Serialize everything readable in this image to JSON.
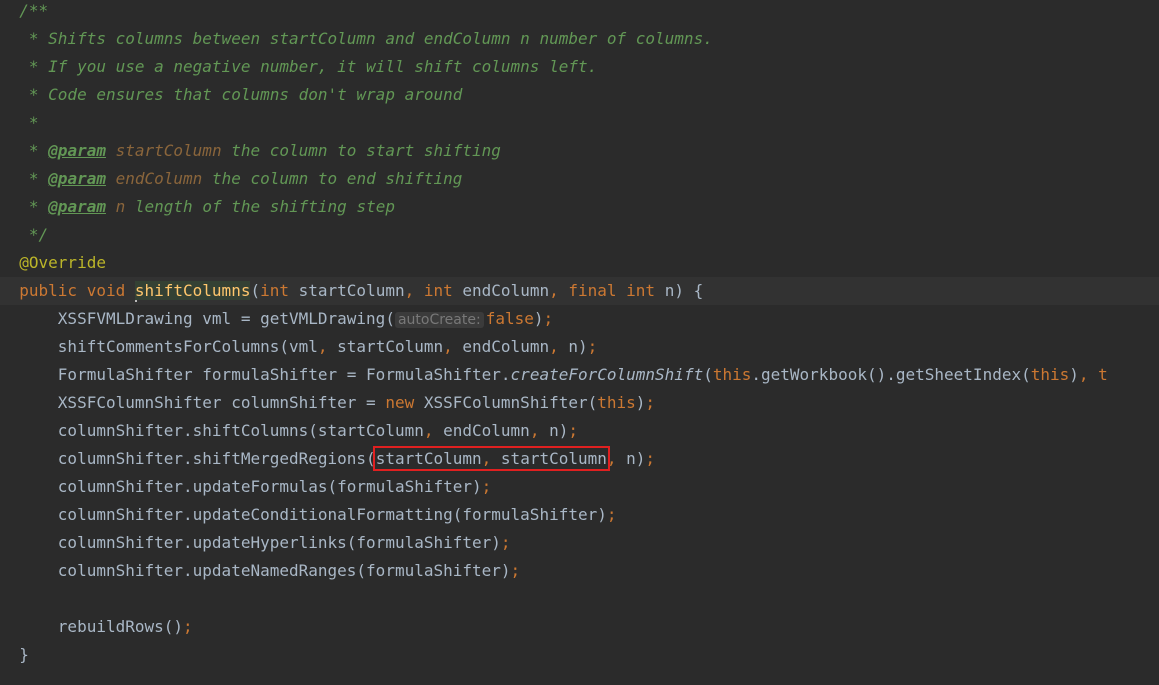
{
  "editor": {
    "theme_colors": {
      "background": "#2b2b2b",
      "text": "#a9b7c6",
      "doc_comment": "#629755",
      "keyword": "#cc7832",
      "annotation": "#bbb529",
      "method_declaration": "#ffc66d",
      "highlight_box": "#e02020"
    },
    "lines": {
      "l1": {
        "doc": "/**"
      },
      "l2": {
        "doc": " * Shifts columns between startColumn and endColumn n number of columns."
      },
      "l3": {
        "doc": " * If you use a negative number, it will shift columns left."
      },
      "l4": {
        "doc": " * Code ensures that columns don't wrap around"
      },
      "l5": {
        "doc": " *"
      },
      "l6": {
        "star": " * ",
        "tag": "@param",
        "name": "startColumn",
        "desc": " the column to start shifting"
      },
      "l7": {
        "star": " * ",
        "tag": "@param",
        "name": "endColumn",
        "desc": " the column to end shifting"
      },
      "l8": {
        "star": " * ",
        "tag": "@param",
        "name": "n",
        "desc": " length of the shifting step"
      },
      "l9": {
        "doc": " */"
      },
      "l10": {
        "annotation": "@Override"
      },
      "l11": {
        "kw1": "public void ",
        "method": "shiftColumns",
        "p1": "(",
        "kw2": "int",
        "p2": " startColumn",
        "c1": ", ",
        "kw3": "int",
        "p3": " endColumn",
        "c2": ", ",
        "kw4": "final int",
        "p4": " n) {"
      },
      "l12": {
        "a": "    XSSFVMLDrawing vml = getVMLDrawing(",
        "hint": "autoCreate:",
        "kw": "false",
        "b": ")",
        "semi": ";"
      },
      "l13": {
        "a": "    shiftCommentsForColumns(vml",
        "c1": ", ",
        "b": "startColumn",
        "c2": ", ",
        "c": "endColumn",
        "c3": ", ",
        "d": "n)",
        "semi": ";"
      },
      "l14": {
        "a": "    FormulaShifter formulaShifter = FormulaShifter.",
        "static": "createForColumnShift",
        "b": "(",
        "kw1": "this",
        "c": ".getWorkbook().getSheetIndex(",
        "kw2": "this",
        "d": ")",
        "c1": ", ",
        "e": "t"
      },
      "l15": {
        "a": "    XSSFColumnShifter columnShifter = ",
        "kw1": "new",
        "b": " XSSFColumnShifter(",
        "kw2": "this",
        "c": ")",
        "semi": ";"
      },
      "l16": {
        "a": "    columnShifter.shiftColumns(startColumn",
        "c1": ", ",
        "b": "endColumn",
        "c2": ", ",
        "c": "n)",
        "semi": ";"
      },
      "l17": {
        "a": "    columnShifter.shiftMergedRegions(",
        "boxed1": "startColumn",
        "boxedc": ", ",
        "boxed2": "startColumn",
        "c1": ", ",
        "b": "n)",
        "semi": ";"
      },
      "l18": {
        "a": "    columnShifter.updateFormulas(formulaShifter)",
        "semi": ";"
      },
      "l19": {
        "a": "    columnShifter.updateConditionalFormatting(formulaShifter)",
        "semi": ";"
      },
      "l20": {
        "a": "    columnShifter.updateHyperlinks(formulaShifter)",
        "semi": ";"
      },
      "l21": {
        "a": "    columnShifter.updateNamedRanges(formulaShifter)",
        "semi": ";"
      },
      "l22": {
        "a": ""
      },
      "l23": {
        "a": "    rebuildRows()",
        "semi": ";"
      },
      "l24": {
        "a": "}"
      }
    }
  }
}
